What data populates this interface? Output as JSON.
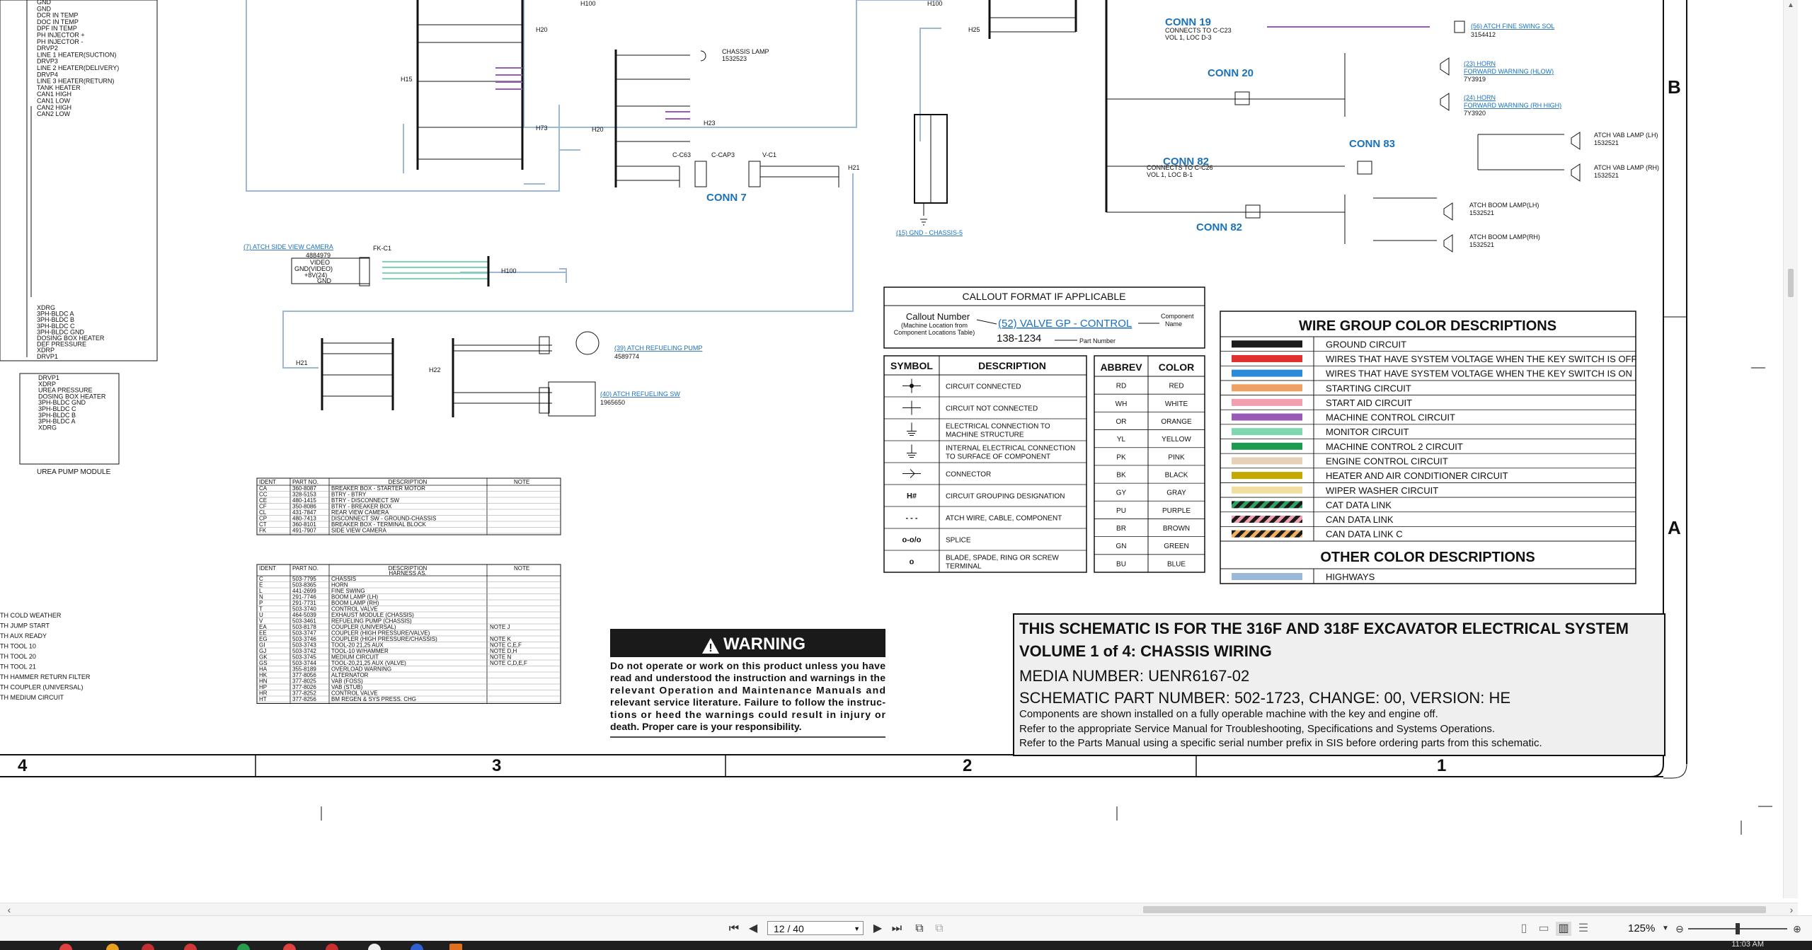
{
  "document": {
    "title_block": {
      "line1": "THIS SCHEMATIC IS FOR THE 316F AND 318F EXCAVATOR ELECTRICAL SYSTEM",
      "line2": "VOLUME 1 of 4: CHASSIS WIRING",
      "line3": "MEDIA NUMBER: UENR6167-02",
      "line4": "SCHEMATIC PART NUMBER: 502-1723, CHANGE: 00, VERSION: HE",
      "note1": "Components are shown installed on a fully operable machine with the key and engine off.",
      "note2": "Refer to the appropriate Service Manual for Troubleshooting, Specifications and Systems Operations.",
      "note3": "Refer to the Parts Manual using a specific serial number prefix in SIS before ordering parts from this schematic."
    },
    "warning": {
      "title": "WARNING",
      "lines": [
        "Do not operate or work on this product unless you have",
        "read and understood the instruction and warnings in the",
        "relevant Operation and Maintenance Manuals and",
        "relevant service literature. Failure to follow the instruc-",
        "tions or heed the warnings could result in injury or",
        "death. Proper care is your responsibility."
      ]
    },
    "callout": {
      "title": "CALLOUT FORMAT IF APPLICABLE",
      "callout_number": "Callout Number",
      "callout_sub1": "(Machine Location from",
      "callout_sub2": "Component Locations Table)",
      "example": "(52) VALVE GP - CONTROL",
      "part": "138-1234",
      "part_label": "Part Number",
      "component": "Component",
      "name": "Name"
    },
    "symbols": {
      "headers": [
        "SYMBOL",
        "DESCRIPTION"
      ],
      "rows": [
        {
          "glyph": "dot-cross",
          "desc": [
            "CIRCUIT CONNECTED"
          ]
        },
        {
          "glyph": "cross",
          "desc": [
            "CIRCUIT NOT CONNECTED"
          ]
        },
        {
          "glyph": "ground",
          "desc": [
            "ELECTRICAL CONNECTION TO",
            "MACHINE STRUCTURE"
          ]
        },
        {
          "glyph": "ground-int",
          "desc": [
            "INTERNAL ELECTRICAL CONNECTION",
            "TO SURFACE OF COMPONENT"
          ]
        },
        {
          "glyph": "connector",
          "desc": [
            "CONNECTOR"
          ]
        },
        {
          "glyph": "H#",
          "desc": [
            "CIRCUIT GROUPING DESIGNATION"
          ]
        },
        {
          "glyph": "- - -",
          "desc": [
            "ATCH WIRE, CABLE, COMPONENT"
          ]
        },
        {
          "glyph": "o-o/o",
          "desc": [
            "SPLICE"
          ]
        },
        {
          "glyph": "o",
          "desc": [
            "BLADE, SPADE, RING OR SCREW",
            "TERMINAL"
          ]
        }
      ]
    },
    "abbrev": {
      "headers": [
        "ABBREV",
        "COLOR"
      ],
      "rows": [
        [
          "RD",
          "RED"
        ],
        [
          "WH",
          "WHITE"
        ],
        [
          "OR",
          "ORANGE"
        ],
        [
          "YL",
          "YELLOW"
        ],
        [
          "PK",
          "PINK"
        ],
        [
          "BK",
          "BLACK"
        ],
        [
          "GY",
          "GRAY"
        ],
        [
          "PU",
          "PURPLE"
        ],
        [
          "BR",
          "BROWN"
        ],
        [
          "GN",
          "GREEN"
        ],
        [
          "BU",
          "BLUE"
        ]
      ]
    },
    "wire_groups": {
      "title": "WIRE GROUP COLOR DESCRIPTIONS",
      "rows": [
        {
          "color": "#1a1a1a",
          "label": "GROUND CIRCUIT"
        },
        {
          "color": "#e03030",
          "label": "WIRES THAT HAVE SYSTEM VOLTAGE WHEN THE KEY SWITCH IS OFF"
        },
        {
          "color": "#2b8bd8",
          "label": "WIRES THAT HAVE SYSTEM VOLTAGE WHEN THE KEY SWITCH IS ON"
        },
        {
          "color": "#f0a060",
          "label": "STARTING CIRCUIT"
        },
        {
          "color": "#f2a0b0",
          "label": "START AID CIRCUIT"
        },
        {
          "color": "#9b59b6",
          "label": "MACHINE CONTROL CIRCUIT"
        },
        {
          "color": "#7fd6b0",
          "label": "MONITOR CIRCUIT"
        },
        {
          "color": "#1f9a50",
          "label": "MACHINE CONTROL 2 CIRCUIT"
        },
        {
          "color": "#e8d0b8",
          "label": "ENGINE CONTROL CIRCUIT"
        },
        {
          "color": "#c4a800",
          "label": "HEATER AND AIR CONDITIONER CIRCUIT"
        },
        {
          "color": "#f2dfa0",
          "label": "WIPER WASHER CIRCUIT"
        },
        {
          "color": "stripe-green",
          "label": "CAT DATA LINK"
        },
        {
          "color": "stripe-pink",
          "label": "CAN DATA LINK"
        },
        {
          "color": "stripe-orange",
          "label": "CAN DATA LINK C"
        }
      ],
      "other_title": "OTHER COLOR DESCRIPTIONS",
      "other": [
        {
          "color": "#9bb8d8",
          "label": "HIGHWAYS"
        }
      ]
    },
    "ident_table1": {
      "headers": [
        "IDENT",
        "PART NO.",
        "DESCRIPTION",
        "NOTE"
      ],
      "subtitle": "",
      "rows": [
        [
          "CA",
          "360-8087",
          "BREAKER BOX - STARTER MOTOR",
          ""
        ],
        [
          "CC",
          "328-5153",
          "BTRY - BTRY",
          ""
        ],
        [
          "CE",
          "480-1415",
          "BTRY - DISCONNECT SW",
          ""
        ],
        [
          "CF",
          "350-8086",
          "BTRY - BREAKER BOX",
          ""
        ],
        [
          "CL",
          "431-7847",
          "REAR VIEW CAMERA",
          ""
        ],
        [
          "CP",
          "480-7413",
          "DISCONNECT SW - GROUND-CHASSIS",
          ""
        ],
        [
          "CT",
          "360-8101",
          "BREAKER BOX - TERMINAL BLOCK",
          ""
        ],
        [
          "FK",
          "491-7907",
          "SIDE VIEW CAMERA",
          ""
        ]
      ]
    },
    "ident_table2": {
      "headers": [
        "IDENT",
        "PART NO.",
        "DESCRIPTION",
        "NOTE"
      ],
      "subtitle": "HARNESS AS.",
      "rows": [
        [
          "C",
          "503-7795",
          "CHASSIS",
          ""
        ],
        [
          "E",
          "503-8365",
          "HORN",
          ""
        ],
        [
          "L",
          "441-2699",
          "FINE SWING",
          ""
        ],
        [
          "N",
          "291-7746",
          "BOOM LAMP (LH)",
          ""
        ],
        [
          "P",
          "291-7731",
          "BOOM LAMP (RH)",
          ""
        ],
        [
          "T",
          "503-3740",
          "CONTROL VALVE",
          ""
        ],
        [
          "U",
          "464-5039",
          "EXHAUST MODULE (CHASSIS)",
          ""
        ],
        [
          "V",
          "503-3461",
          "REFUELING PUMP (CHASSIS)",
          ""
        ],
        [
          "EA",
          "503-8178",
          "COUPLER (UNIVERSAL)",
          "NOTE J"
        ],
        [
          "EE",
          "503-3747",
          "COUPLER (HIGH PRESSURE/VALVE)",
          ""
        ],
        [
          "EG",
          "503-3746",
          "COUPLER (HIGH PRESSURE/CHASSIS)",
          "NOTE K"
        ],
        [
          "GI",
          "503-3743",
          "TOOL-20 21,25 AUX",
          "NOTE C,E,F"
        ],
        [
          "GJ",
          "503-3742",
          "TOOL-10 W/HAMMER",
          "NOTE D,H"
        ],
        [
          "GK",
          "503-3745",
          "MEDIUM CIRCUIT",
          "NOTE N"
        ],
        [
          "GS",
          "503-3744",
          "TOOL-20,21,25 AUX (VALVE)",
          "NOTE C,D,E,F"
        ],
        [
          "HA",
          "355-8189",
          "OVERLOAD WARNING",
          ""
        ],
        [
          "HK",
          "377-8056",
          "ALTERNATOR",
          ""
        ],
        [
          "HN",
          "377-8025",
          "VAB (FOSS)",
          ""
        ],
        [
          "HP",
          "377-8026",
          "VAB (STUB)",
          ""
        ],
        [
          "HR",
          "377-8252",
          "CONTROL VALVE",
          ""
        ],
        [
          "HT",
          "377-8256",
          "BM REGEN & SYS PRESS. CHG",
          ""
        ]
      ]
    },
    "left_notes": [
      "TH COLD WEATHER",
      "TH JUMP START",
      "TH AUX READY",
      "TH TOOL 10",
      "TH TOOL 20",
      "TH TOOL 21",
      "TH HAMMER RETURN FILTER",
      "TH COUPLER (UNIVERSAL)",
      "TH MEDIUM CIRCUIT"
    ],
    "left_list_top": [
      "GND",
      "GND",
      "DCR IN TEMP",
      "DOC IN TEMP",
      "DPF IN TEMP",
      "PH INJECTOR +",
      "PH INJECTOR -",
      "DRVP2",
      "LINE 1 HEATER(SUCTION)",
      "DRVP3",
      "LINE 2 HEATER(DELIVERY)",
      "DRVP4",
      "LINE 3 HEATER(RETURN)",
      "TANK HEATER",
      "CAN1 HIGH",
      "CAN1 LOW",
      "CAN2 HIGH",
      "CAN2 LOW"
    ],
    "left_list_mid": [
      "XDRG",
      "3PH-BLDC A",
      "3PH-BLDC B",
      "3PH-BLDC C",
      "3PH-BLDC GND",
      "DOSING BOX HEATER",
      "DEF PRESSURE",
      "XDRP",
      "DRVP1"
    ],
    "urea_list": [
      "DRVP1",
      "XDRP",
      "UREA PRESSURE",
      "DOSING BOX HEATER",
      "3PH-BLDC GND",
      "3PH-BLDC C",
      "3PH-BLDC B",
      "3PH-BLDC A",
      "XDRG"
    ],
    "urea_title": "UREA PUMP MODULE",
    "conn_labels": [
      "CONN 19",
      "CONN 20",
      "CONN 82",
      "CONN 83",
      "CONN 82",
      "CONN 7"
    ],
    "links": [
      "(7) ATCH SIDE VIEW CAMERA",
      "(39) ATCH REFUELING PUMP",
      "(40) ATCH REFUELING SW",
      "(15) GND - CHASSIS-5",
      "(56) ATCH FINE SWING SOL",
      "(23) HORN",
      "FORWARD WARNING (HLOW)",
      "(24) HORN",
      "FORWARD WARNING (RH HIGH)"
    ],
    "component_labels": [
      "CHASSIS LAMP",
      "ATCH VAB LAMP (LH)",
      "ATCH VAB LAMP (RH)",
      "ATCH BOOM LAMP(LH)",
      "ATCH BOOM LAMP(RH)"
    ],
    "zones": [
      "4",
      "3",
      "2",
      "1"
    ],
    "side_letters": [
      "B",
      "A"
    ]
  },
  "viewer": {
    "page_field": "12 / 40",
    "zoom": "125%",
    "clock": "11:03 AM"
  }
}
